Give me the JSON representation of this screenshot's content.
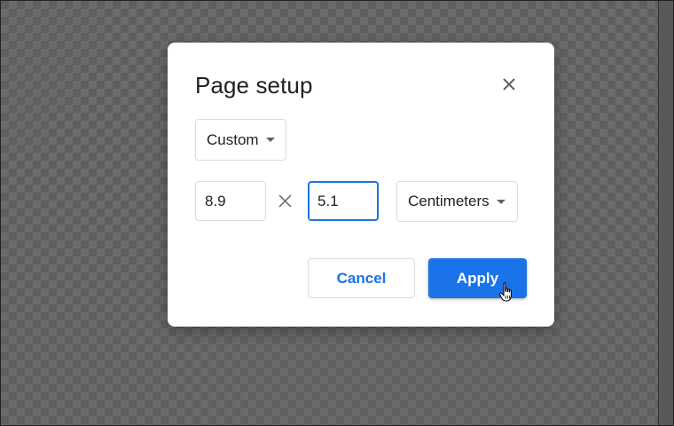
{
  "dialog": {
    "title": "Page setup",
    "close_icon": "close-icon"
  },
  "preset": {
    "selected": "Custom",
    "icon": "chevron-down-icon"
  },
  "dimensions": {
    "width_value": "8.9",
    "height_value": "5.1",
    "separator_icon": "times-icon",
    "unit_selected": "Centimeters"
  },
  "buttons": {
    "cancel_label": "Cancel",
    "apply_label": "Apply"
  },
  "colors": {
    "accent": "#1a73e8",
    "text": "#202124",
    "border": "#dadce0",
    "backdrop": "#5f5f5f"
  },
  "cursor": {
    "icon": "hand-pointer-icon"
  }
}
